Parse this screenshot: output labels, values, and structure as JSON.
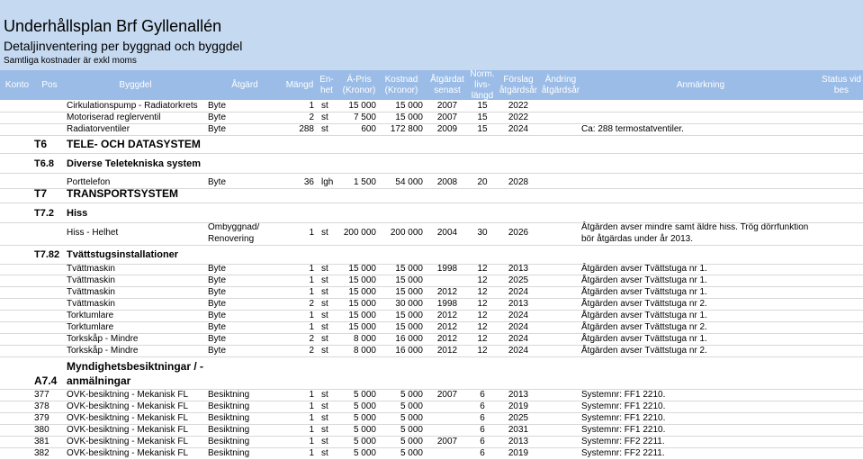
{
  "title": "Underhållsplan Brf Gyllenallén",
  "subtitle": "Detaljinventering per byggnad och byggdel",
  "note": "Samtliga kostnader är exkl moms",
  "headers": {
    "konto": "Konto",
    "pos": "Pos",
    "byggdel": "Byggdel",
    "atgard": "Åtgärd",
    "mangd": "Mängd",
    "enhet": "En-\nhet",
    "apris": "Á-Pris\n(Kronor)",
    "kostnad": "Kostnad\n(Kronor)",
    "senast": "Åtgärdat\nsenast",
    "livslangd": "Norm.\nlivs-\nlängd",
    "forslag": "Förslag\nåtgärdsår",
    "andring": "Ändring\nåtgärdsår",
    "anmarkning": "Anmärkning",
    "status": "Status vid\nbes"
  },
  "rows": [
    {
      "pos": "",
      "byggdel": "Cirkulationspump - Radiatorkrets",
      "atgard": "Byte",
      "mangd": "1",
      "enhet": "st",
      "apris": "15 000",
      "kostnad": "15 000",
      "senast": "2007",
      "livslangd": "15",
      "forslag": "2022",
      "anmarkning": ""
    },
    {
      "pos": "",
      "byggdel": "Motoriserad reglerventil",
      "atgard": "Byte",
      "mangd": "2",
      "enhet": "st",
      "apris": "7 500",
      "kostnad": "15 000",
      "senast": "2007",
      "livslangd": "15",
      "forslag": "2022",
      "anmarkning": ""
    },
    {
      "pos": "",
      "byggdel": "Radiatorventiler",
      "atgard": "Byte",
      "mangd": "288",
      "enhet": "st",
      "apris": "600",
      "kostnad": "172 800",
      "senast": "2009",
      "livslangd": "15",
      "forslag": "2024",
      "anmarkning": "Ca: 288 termostatventiler."
    },
    {
      "pos": "",
      "byggdel": "Porttelefon",
      "atgard": "Byte",
      "mangd": "36",
      "enhet": "lgh",
      "apris": "1 500",
      "kostnad": "54 000",
      "senast": "2008",
      "livslangd": "20",
      "forslag": "2028",
      "anmarkning": ""
    },
    {
      "pos": "",
      "byggdel": "Hiss - Helhet",
      "atgard": "Ombyggnad/ Renovering",
      "mangd": "1",
      "enhet": "st",
      "apris": "200 000",
      "kostnad": "200 000",
      "senast": "2004",
      "livslangd": "30",
      "forslag": "2026",
      "anmarkning": "Åtgärden avser mindre samt äldre hiss. Trög dörrfunktion bör åtgärdas under år 2013."
    },
    {
      "pos": "",
      "byggdel": "Tvättmaskin",
      "atgard": "Byte",
      "mangd": "1",
      "enhet": "st",
      "apris": "15 000",
      "kostnad": "15 000",
      "senast": "1998",
      "livslangd": "12",
      "forslag": "2013",
      "anmarkning": "Åtgärden avser Tvättstuga nr 1."
    },
    {
      "pos": "",
      "byggdel": "Tvättmaskin",
      "atgard": "Byte",
      "mangd": "1",
      "enhet": "st",
      "apris": "15 000",
      "kostnad": "15 000",
      "senast": "",
      "livslangd": "12",
      "forslag": "2025",
      "anmarkning": "Åtgärden avser Tvättstuga nr 1."
    },
    {
      "pos": "",
      "byggdel": "Tvättmaskin",
      "atgard": "Byte",
      "mangd": "1",
      "enhet": "st",
      "apris": "15 000",
      "kostnad": "15 000",
      "senast": "2012",
      "livslangd": "12",
      "forslag": "2024",
      "anmarkning": "Åtgärden avser Tvättstuga nr 1."
    },
    {
      "pos": "",
      "byggdel": "Tvättmaskin",
      "atgard": "Byte",
      "mangd": "2",
      "enhet": "st",
      "apris": "15 000",
      "kostnad": "30 000",
      "senast": "1998",
      "livslangd": "12",
      "forslag": "2013",
      "anmarkning": "Åtgärden avser Tvättstuga nr 2."
    },
    {
      "pos": "",
      "byggdel": "Torktumlare",
      "atgard": "Byte",
      "mangd": "1",
      "enhet": "st",
      "apris": "15 000",
      "kostnad": "15 000",
      "senast": "2012",
      "livslangd": "12",
      "forslag": "2024",
      "anmarkning": "Åtgärden avser Tvättstuga nr 1."
    },
    {
      "pos": "",
      "byggdel": "Torktumlare",
      "atgard": "Byte",
      "mangd": "1",
      "enhet": "st",
      "apris": "15 000",
      "kostnad": "15 000",
      "senast": "2012",
      "livslangd": "12",
      "forslag": "2024",
      "anmarkning": "Åtgärden avser Tvättstuga nr 2."
    },
    {
      "pos": "",
      "byggdel": "Torkskåp - Mindre",
      "atgard": "Byte",
      "mangd": "2",
      "enhet": "st",
      "apris": "8 000",
      "kostnad": "16 000",
      "senast": "2012",
      "livslangd": "12",
      "forslag": "2024",
      "anmarkning": "Åtgärden avser Tvättstuga nr 1."
    },
    {
      "pos": "",
      "byggdel": "Torkskåp - Mindre",
      "atgard": "Byte",
      "mangd": "2",
      "enhet": "st",
      "apris": "8 000",
      "kostnad": "16 000",
      "senast": "2012",
      "livslangd": "12",
      "forslag": "2024",
      "anmarkning": "Åtgärden avser Tvättstuga nr 2."
    },
    {
      "pos": "377",
      "byggdel": "OVK-besiktning - Mekanisk FL",
      "atgard": "Besiktning",
      "mangd": "1",
      "enhet": "st",
      "apris": "5 000",
      "kostnad": "5 000",
      "senast": "2007",
      "livslangd": "6",
      "forslag": "2013",
      "anmarkning": "Systemnr: FF1 2210."
    },
    {
      "pos": "378",
      "byggdel": "OVK-besiktning - Mekanisk FL",
      "atgard": "Besiktning",
      "mangd": "1",
      "enhet": "st",
      "apris": "5 000",
      "kostnad": "5 000",
      "senast": "",
      "livslangd": "6",
      "forslag": "2019",
      "anmarkning": "Systemnr: FF1 2210."
    },
    {
      "pos": "379",
      "byggdel": "OVK-besiktning - Mekanisk FL",
      "atgard": "Besiktning",
      "mangd": "1",
      "enhet": "st",
      "apris": "5 000",
      "kostnad": "5 000",
      "senast": "",
      "livslangd": "6",
      "forslag": "2025",
      "anmarkning": "Systemnr: FF1 2210."
    },
    {
      "pos": "380",
      "byggdel": "OVK-besiktning - Mekanisk FL",
      "atgard": "Besiktning",
      "mangd": "1",
      "enhet": "st",
      "apris": "5 000",
      "kostnad": "5 000",
      "senast": "",
      "livslangd": "6",
      "forslag": "2031",
      "anmarkning": "Systemnr: FF1 2210."
    },
    {
      "pos": "381",
      "byggdel": "OVK-besiktning - Mekanisk FL",
      "atgard": "Besiktning",
      "mangd": "1",
      "enhet": "st",
      "apris": "5 000",
      "kostnad": "5 000",
      "senast": "2007",
      "livslangd": "6",
      "forslag": "2013",
      "anmarkning": "Systemnr: FF2 2211."
    },
    {
      "pos": "382",
      "byggdel": "OVK-besiktning - Mekanisk FL",
      "atgard": "Besiktning",
      "mangd": "1",
      "enhet": "st",
      "apris": "5 000",
      "kostnad": "5 000",
      "senast": "",
      "livslangd": "6",
      "forslag": "2019",
      "anmarkning": "Systemnr: FF2 2211."
    }
  ],
  "sections": [
    {
      "konto": "T6",
      "name": "TELE- OCH DATASYSTEM"
    },
    {
      "konto": "T6.8",
      "name": "Diverse Teletekniska system"
    },
    {
      "konto": "T7",
      "name": "TRANSPORTSYSTEM"
    },
    {
      "konto": "T7.2",
      "name": "Hiss"
    },
    {
      "konto": "T7.82",
      "name": "Tvättstugsinstallationer"
    },
    {
      "konto": "A7.4",
      "name": "Myndighetsbesiktningar / -\nanmälningar"
    }
  ],
  "colors": {
    "banner": "#c5d9f1",
    "header": "#9bbce6",
    "grid": "#d8d8d8"
  }
}
